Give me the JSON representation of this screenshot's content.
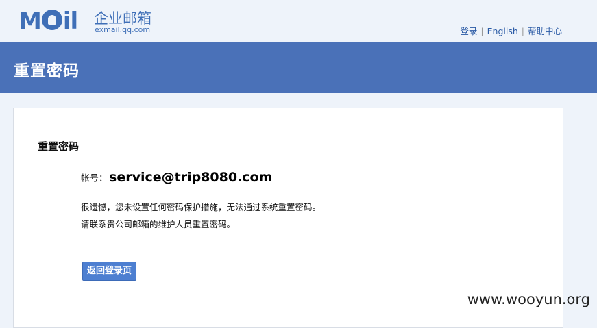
{
  "logo": {
    "mark": "MOil",
    "brand_cn": "企业邮箱",
    "domain": "exmail.qq.com"
  },
  "top_links": {
    "login": "登录",
    "english": "English",
    "help": "帮助中心",
    "separator": "|"
  },
  "header": {
    "title": "重置密码"
  },
  "panel": {
    "title": "重置密码",
    "account_label": "帐号：",
    "account_value": "service@trip8080.com",
    "message_line1": "很遗憾，您未设置任何密码保护措施，无法通过系统重置密码。",
    "message_line2": "请联系贵公司邮箱的维护人员重置密码。",
    "back_button": "返回登录页"
  },
  "watermark": "www.wooyun.org",
  "colors": {
    "page_bg": "#eef3fa",
    "header_band": "#4a71b8",
    "brand_blue": "#3f6fb7",
    "link_blue": "#2a5aa5",
    "button_blue": "#4d7fd1"
  }
}
